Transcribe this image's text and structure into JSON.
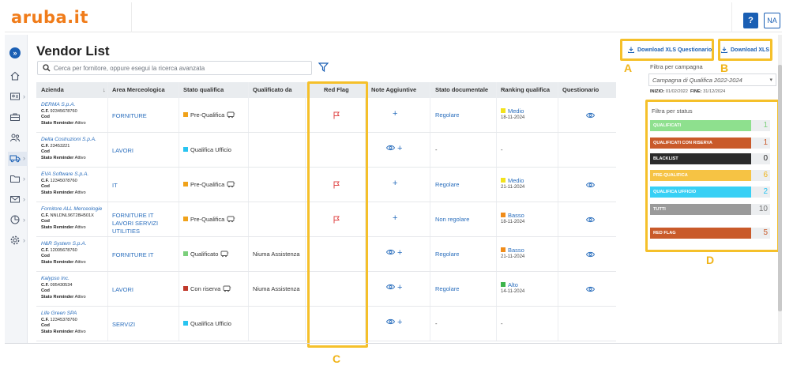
{
  "app": {
    "logo_text": "aruba.it",
    "help_label": "?",
    "user_initials": "NA"
  },
  "page": {
    "title": "Vendor List",
    "search_placeholder": "Cerca per fornitore, oppure esegui la ricerca avanzata"
  },
  "table": {
    "headers": {
      "azienda": "Azienda",
      "area": "Area Merceologica",
      "stato": "Stato qualifica",
      "qualificato_da": "Qualificato da",
      "red_flag": "Red Flag",
      "note": "Note Aggiuntive",
      "stato_doc": "Stato documentale",
      "ranking": "Ranking qualifica",
      "questionario": "Questionario"
    },
    "sort_icon": "↓",
    "cf_label": "C.F.",
    "cod_label": "Cod",
    "reminder_label": "Stato Reminder",
    "rows": [
      {
        "name": "DERMA S.p.A.",
        "cf": "92345678760",
        "reminder": "Attivo",
        "area": "FORNITURE",
        "stato": "Pre-Qualifica",
        "stato_color": "#f0a21a",
        "qualificato_da": "",
        "red_flag": true,
        "note": "+",
        "doc": "Regolare",
        "rank": "Medio",
        "rank_color": "#f2e21c",
        "rank_date": "18-11-2024",
        "questionario": true
      },
      {
        "name": "Delta Costruzioni S.p.A.",
        "cf": "23453221",
        "reminder": "Attivo",
        "area": "LAVORI",
        "stato": "Qualifica Ufficio",
        "stato_color": "#29c4f0",
        "qualificato_da": "",
        "red_flag": false,
        "note": "+",
        "doc": "-",
        "rank": "-",
        "rank_color": "",
        "rank_date": "",
        "questionario": false
      },
      {
        "name": "EVA Software S.p.A.",
        "cf": "12345078760",
        "reminder": "Attivo",
        "area": "IT",
        "stato": "Pre-Qualifica",
        "stato_color": "#f0a21a",
        "qualificato_da": "",
        "red_flag": true,
        "note": "+",
        "doc": "Regolare",
        "rank": "Medio",
        "rank_color": "#f2e21c",
        "rank_date": "21-11-2024",
        "questionario": true
      },
      {
        "name": "Fornitore ALL Merceologie",
        "cf": "NNLDNL96T28H501X",
        "reminder": "Attivo",
        "area": "FORNITURE IT LAVORI SERVIZI UTILITIES",
        "stato": "Pre-Qualifica",
        "stato_color": "#f0a21a",
        "qualificato_da": "",
        "red_flag": true,
        "note": "+",
        "doc": "Non regolare",
        "rank": "Basso",
        "rank_color": "#f08c1a",
        "rank_date": "18-11-2024",
        "questionario": true
      },
      {
        "name": "H&R System S.p.A.",
        "cf": "12005678760",
        "reminder": "Attivo",
        "area": "FORNITURE IT",
        "stato": "Qualificato",
        "stato_color": "#7ccf7c",
        "qualificato_da": "Niuma Assistenza",
        "red_flag": false,
        "note": "+",
        "doc": "Regolare",
        "rank": "Basso",
        "rank_color": "#f08c1a",
        "rank_date": "21-11-2024",
        "questionario": true
      },
      {
        "name": "Kalypso Inc.",
        "cf": "095430534",
        "reminder": "Attivo",
        "area": "LAVORI",
        "stato": "Con riserva",
        "stato_color": "#c0392b",
        "qualificato_da": "Niuma Assistenza",
        "red_flag": false,
        "note": "+",
        "doc": "Regolare",
        "rank": "Alto",
        "rank_color": "#3cb44b",
        "rank_date": "14-11-2024",
        "questionario": true
      },
      {
        "name": "Life Green SPA",
        "cf": "12345378760",
        "reminder": "Attivo",
        "area": "SERVIZI",
        "stato": "Qualifica Ufficio",
        "stato_color": "#29c4f0",
        "qualificato_da": "",
        "red_flag": false,
        "note": "+",
        "doc": "-",
        "rank": "-",
        "rank_color": "",
        "rank_date": "",
        "questionario": false
      }
    ]
  },
  "right_panel": {
    "download_questionario": "Download XLS Questionario",
    "download_xls": "Download XLS",
    "campaign_label": "Filtra per campagna",
    "campaign_value": "Campagna di Qualifica 2022-2024",
    "inizio_label": "INIZIO:",
    "inizio_value": "01/02/2022",
    "fine_label": "FINE:",
    "fine_value": "31/12/2024",
    "status_label": "Filtra per status",
    "statuses": [
      {
        "label": "QUALIFICATI",
        "count": "1",
        "color": "#8ee08e",
        "count_color": "#7ccf7c"
      },
      {
        "label": "QUALIFICATI CON RISERVA",
        "count": "1",
        "color": "#c95a2a",
        "count_color": "#c95a2a"
      },
      {
        "label": "BLACKLIST",
        "count": "0",
        "color": "#2b2b2b",
        "count_color": "#2b2b2b"
      },
      {
        "label": "PRE-QUALIFICA",
        "count": "6",
        "color": "#f6c344",
        "count_color": "#f0b41a"
      },
      {
        "label": "QUALIFICA UFFICIO",
        "count": "2",
        "color": "#38d0f5",
        "count_color": "#29c4f0"
      },
      {
        "label": "TUTTI",
        "count": "10",
        "color": "#9a9a9a",
        "count_color": "#777777"
      },
      {
        "label": "RED FLAG",
        "count": "5",
        "color": "#c95a2a",
        "count_color": "#c95a2a"
      }
    ]
  },
  "annotations": {
    "a": "A",
    "b": "B",
    "c": "C",
    "d": "D"
  }
}
